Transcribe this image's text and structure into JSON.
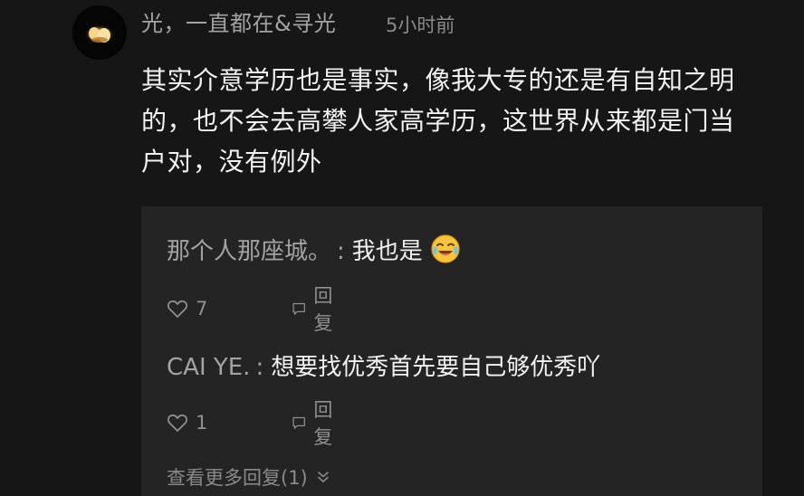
{
  "comment": {
    "username": "光，一直都在&寻光",
    "timestamp": "5小时前",
    "text": "其实介意学历也是事实，像我大专的还是有自知之明的，也不会去高攀人家高学历，这世界从来都是门当户对，没有例外"
  },
  "replies": [
    {
      "author": "那个人那座城。",
      "separator": ":",
      "text": "我也是",
      "emoji": "crying-laughing-emoji",
      "likes": "7",
      "reply_label": "回复"
    },
    {
      "author": "CAI YE.",
      "separator": ":",
      "text": "想要找优秀首先要自己够优秀吖",
      "likes": "1",
      "reply_label": "回复"
    }
  ],
  "more_replies": {
    "label": "查看更多回复(1)"
  },
  "colors": {
    "background": "#161616",
    "reply_panel": "#242424",
    "primary_text": "#f2f2f2",
    "secondary_text": "#a3a3a3"
  }
}
